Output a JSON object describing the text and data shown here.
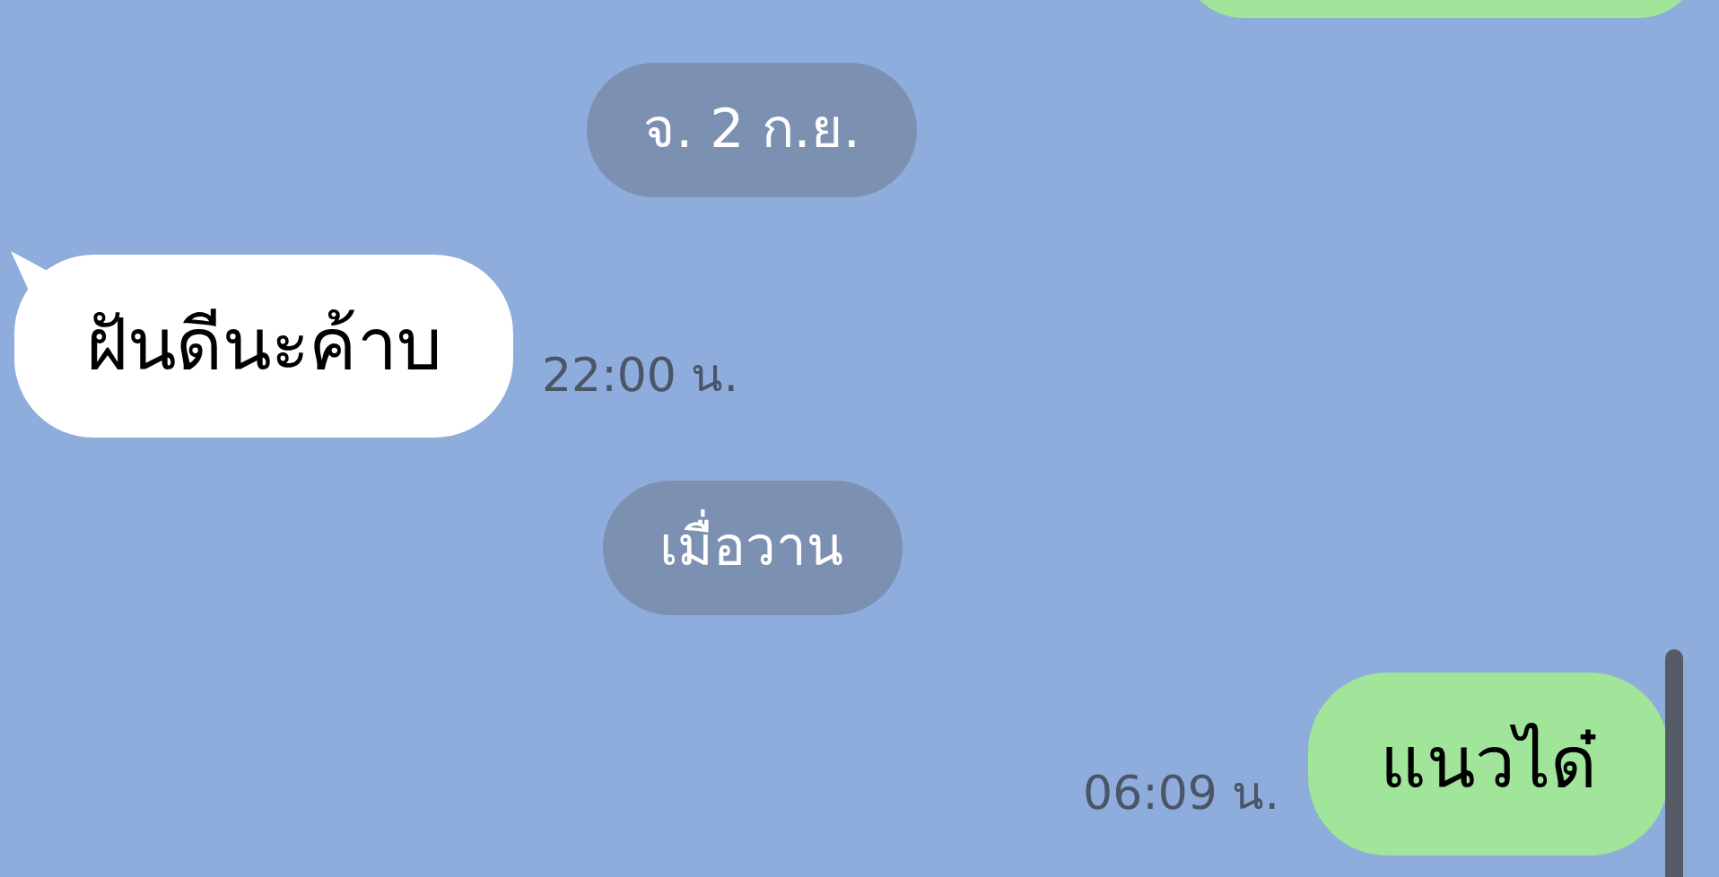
{
  "messages": [
    {
      "kind": "date",
      "text": "จ. 2 ก.ย."
    },
    {
      "kind": "incoming",
      "text": "ฝันดีนะค้าบ",
      "time": "22:00 น."
    },
    {
      "kind": "date",
      "text": "เมื่อวาน"
    },
    {
      "kind": "outgoing",
      "text": "แนวได๋",
      "time": "06:09 น."
    }
  ]
}
